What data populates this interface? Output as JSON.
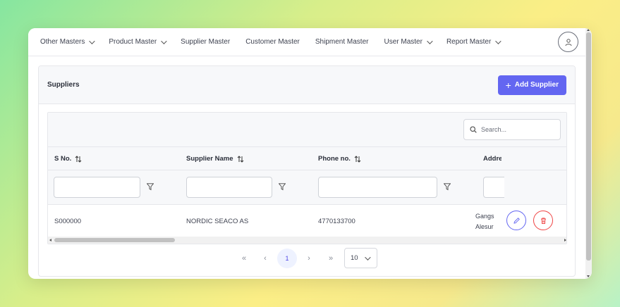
{
  "nav": {
    "items": [
      {
        "label": "Other Masters",
        "dropdown": true
      },
      {
        "label": "Product Master",
        "dropdown": true
      },
      {
        "label": "Supplier Master",
        "dropdown": false
      },
      {
        "label": "Customer Master",
        "dropdown": false
      },
      {
        "label": "Shipment Master",
        "dropdown": false
      },
      {
        "label": "User Master",
        "dropdown": true
      },
      {
        "label": "Report Master",
        "dropdown": true
      }
    ],
    "avatar_icon": "user-icon"
  },
  "card": {
    "title": "Suppliers",
    "add_button_label": "Add Supplier"
  },
  "search": {
    "placeholder": "Search..."
  },
  "table": {
    "columns": [
      "S No.",
      "Supplier Name",
      "Phone no.",
      "Addre"
    ],
    "rows": [
      {
        "sno": "S000000",
        "name": "NORDIC SEACO AS",
        "phone": "4770133700",
        "address_line1": "Gangs",
        "address_line2": "Alesur"
      }
    ]
  },
  "pagination": {
    "current_page": "1",
    "rows_per_page": "10"
  },
  "colors": {
    "accent": "#6366f1",
    "danger": "#ef4444"
  }
}
